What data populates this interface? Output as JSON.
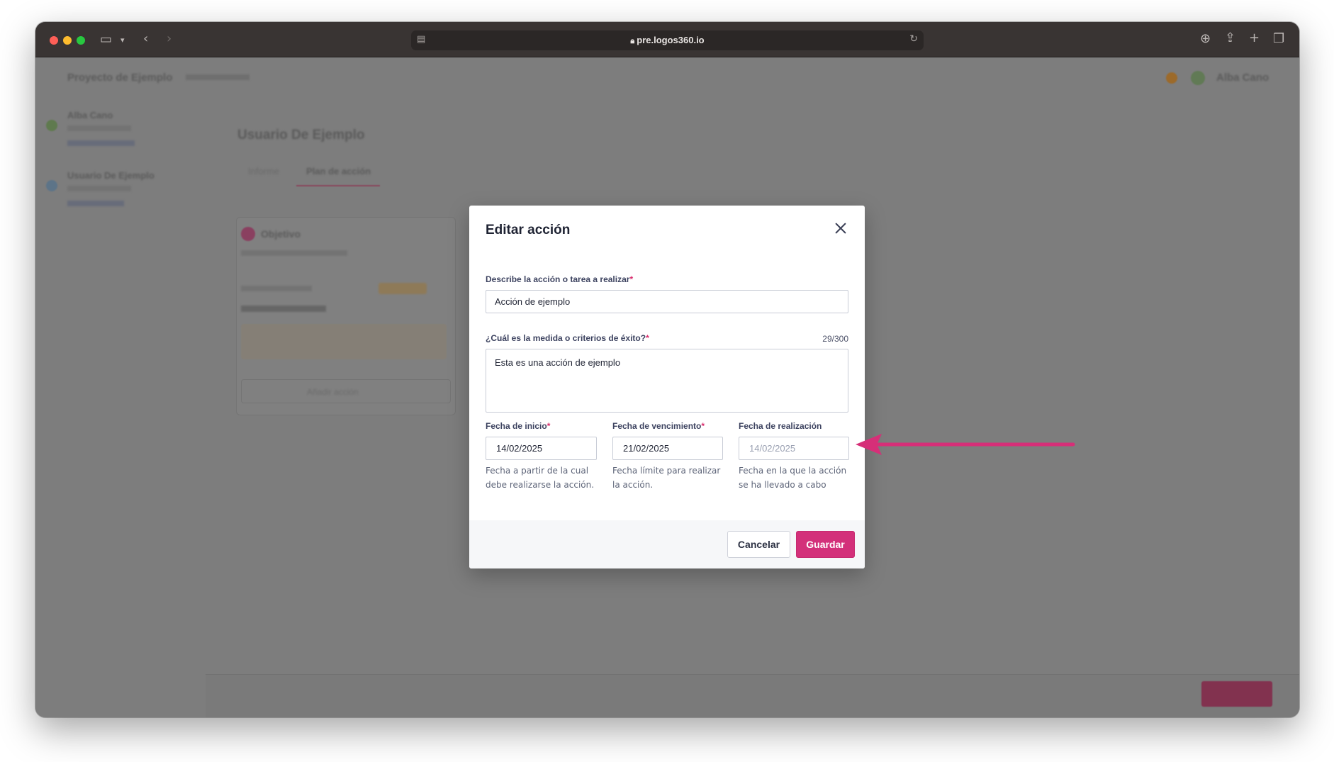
{
  "browser": {
    "url": "pre.logos360.io"
  },
  "background_app": {
    "project_title": "Proyecto de Ejemplo",
    "project_subtitle": "",
    "user_name": "Alba Cano",
    "sidebar_items": [
      {
        "name": "Alba Cano",
        "sub1": "",
        "sub2": ""
      },
      {
        "name": "Usuario De Ejemplo",
        "sub1": "",
        "sub2": ""
      }
    ],
    "page_title": "Usuario De Ejemplo",
    "tabs": [
      "Informe",
      "Plan de acción"
    ],
    "objective_label": "Objetivo",
    "add_action_label": "Añadir acción"
  },
  "modal": {
    "title": "Editar acción",
    "action_field": {
      "label": "Describe la acción o tarea a realizar",
      "required_mark": "*",
      "value": "Acción de ejemplo"
    },
    "criteria_field": {
      "label": "¿Cuál es la medida o criterios de éxito?",
      "required_mark": "*",
      "counter": "29/300",
      "value": "Esta es una acción de ejemplo"
    },
    "start_date": {
      "label": "Fecha de inicio",
      "required_mark": "*",
      "value": "14/02/2025",
      "hint": "Fecha a partir de la cual debe realizarse la acción."
    },
    "due_date": {
      "label": "Fecha de vencimiento",
      "required_mark": "*",
      "value": "21/02/2025",
      "hint": "Fecha límite para realizar la acción."
    },
    "completion_date": {
      "label": "Fecha de realización",
      "placeholder": "14/02/2025",
      "hint": "Fecha en la que la acción se ha llevado a cabo"
    },
    "cancel_label": "Cancelar",
    "save_label": "Guardar"
  },
  "colors": {
    "accent": "#d3307a",
    "annotation_arrow": "#d62f78"
  }
}
